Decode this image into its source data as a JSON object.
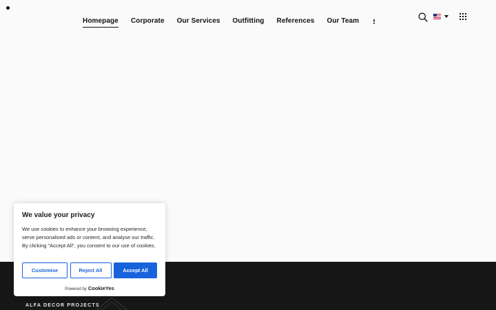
{
  "header": {
    "nav": [
      {
        "label": "Homepage",
        "active": true
      },
      {
        "label": "Corporate"
      },
      {
        "label": "Our Services"
      },
      {
        "label": "Outfitting"
      },
      {
        "label": "References"
      },
      {
        "label": "Our Team"
      }
    ],
    "more_icon": "vertical-ellipsis-icon",
    "search_icon": "search-icon",
    "language_flag": "us-flag-icon",
    "apps_icon": "grid-menu-icon"
  },
  "footer": {
    "brand": "ALFA DECOR PROJECTS",
    "background": "#171717"
  },
  "cookie_banner": {
    "title": "We value your privacy",
    "text": "We use cookies to enhance your browsing experience, serve personalised ads or content, and analyse our traffic. By clicking \"Accept All\", you consent to our use of cookies.",
    "customise_label": "Customise",
    "reject_label": "Reject All",
    "accept_label": "Accept All",
    "powered_by": "Powered by",
    "powered_brand": "CookieYes",
    "accent": "#1863dc"
  }
}
